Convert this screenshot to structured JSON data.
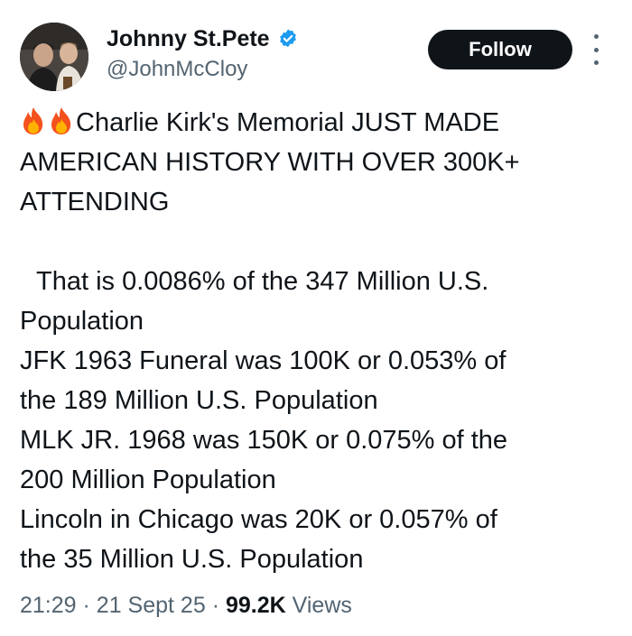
{
  "author": {
    "display_name": "Johnny St.Pete",
    "handle": "@JohnMcCloy",
    "verified": true,
    "avatar_icon": "user-avatar-photo"
  },
  "actions": {
    "follow_label": "Follow",
    "more_icon": "more-options-icon"
  },
  "tweet": {
    "fire_emoji": "fire-icon",
    "lines": [
      "Charlie Kirk's Memorial JUST MADE",
      "AMERICAN HISTORY WITH OVER 300K+",
      "ATTENDING",
      "",
      "That is 0.0086% of the 347 Million U.S.",
      "Population",
      "JFK 1963 Funeral was 100K or 0.053% of",
      "the 189 Million U.S. Population",
      "MLK JR. 1968 was 150K or 0.075% of the",
      "200 Million Population",
      "Lincoln in Chicago was 20K or 0.057% of",
      "the 35 Million U.S. Population"
    ]
  },
  "meta": {
    "time": "21:29",
    "date": "21 Sept 25",
    "separator": "·",
    "views_count": "99.2K",
    "views_label": "Views"
  },
  "colors": {
    "text_primary": "#0f1419",
    "text_secondary": "#536471",
    "verified_blue": "#1d9bf0",
    "follow_bg": "#0f1419"
  }
}
